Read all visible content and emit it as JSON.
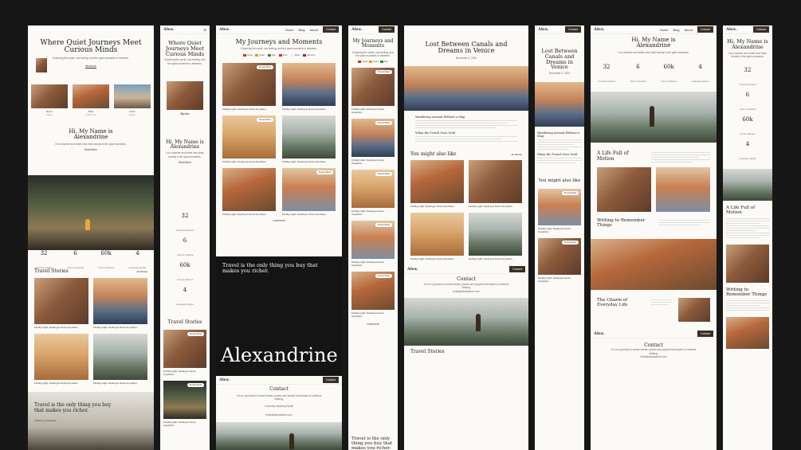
{
  "site": {
    "logo": "Alex.",
    "nav": [
      "Home",
      "Blog",
      "About"
    ],
    "cta": "Contact"
  },
  "home": {
    "hero_title": "Where Quiet Journeys Meet Curious Minds",
    "hero_sub": "Exploring the world, one feeling, and the quiet moments in between.",
    "hero_link": "About me",
    "cards": [
      {
        "name": "Kyoto",
        "tag": "Japan"
      },
      {
        "name": "Bali",
        "tag": "Indonesia"
      },
      {
        "name": "Cairo",
        "tag": "Egypt"
      }
    ],
    "intro_title": "Hi, My Name is Alexandrine",
    "intro_text": "I'm a traveler and writer who finds beauty in the quiet moments.",
    "intro_link": "Read More",
    "stats": [
      {
        "value": "32",
        "label": "Countries explored"
      },
      {
        "value": "6",
        "label": "Years of travelling"
      },
      {
        "value": "60k",
        "label": "Journey followers"
      },
      {
        "value": "4",
        "label": "Languages Spoken"
      }
    ],
    "stories_title": "Travel Stories",
    "stories_link": "All Stories",
    "story_caption": "Finding Light: Feeling at Home Anywhere",
    "story_date": "January 12, 2025",
    "quote": "Travel is the only thing you buy that makes you richer.",
    "quote_link": "Follow my adventure"
  },
  "journeys": {
    "title": "My Journeys and Moments",
    "sub": "Exploring the world, one feeling, and the quiet moments in between.",
    "flags": [
      "Nepal",
      "Spain",
      "Italy",
      "Peru",
      "Japan",
      "Morocco"
    ],
    "caption": "Finding Light: Feeling at Home Anywhere",
    "date": "January 12, 2025",
    "badge": "Sunset Mood",
    "load_more": "Load more",
    "quote": "Travel is the only thing you buy that makes you richer.",
    "big_name": "Alexandrine",
    "contact_title": "Contact",
    "contact_text": "I'm on a journey to create stories, places and people that inspire to continue sharing.",
    "location_label": "Location",
    "location": "Currently exploring Nepal",
    "email_label": "Email",
    "email": "hello@alexandrine.com"
  },
  "post": {
    "title": "Lost Between Canals and Dreams in Venice",
    "date": "December 3, 2024",
    "section1": "Wandering Around Without a Map",
    "section2": "When the Travel Goes Gold",
    "more_title": "You might also like",
    "more_link": "All Stories",
    "caption": "Finding Light: Feeling at Home Anywhere",
    "contact": "Contact",
    "stories": "Travel Stories"
  },
  "post_mobile": {
    "title": "Lost Between Canals and Dreams in Venice",
    "date": "December 3, 2024",
    "section1": "Wandering Around Without a Map",
    "section2": "When the Travel Goes Gold",
    "more_title": "You might also like"
  },
  "about": {
    "title": "Hi, My Name is Alexandrine",
    "sub": "I'm a traveler and writer who finds beauty in the quiet moments.",
    "section1": "A Life Full of Motion",
    "section2": "Writing to Remember Things",
    "section3": "The Charm of Everyday Life",
    "contact": "Contact"
  },
  "about_mobile": {
    "title": "Hi, My Name is Alexandrine",
    "section1": "A Life Full of Motion",
    "section2": "Writing to Remember Things"
  }
}
